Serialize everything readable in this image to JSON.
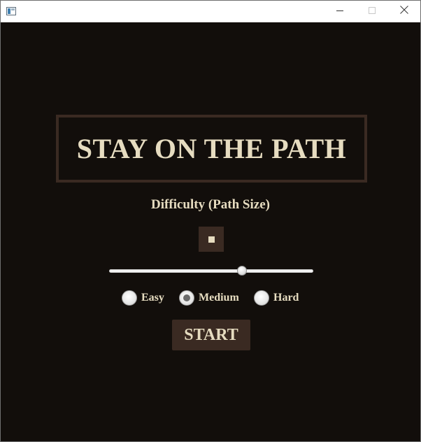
{
  "game": {
    "title": "STAY ON THE PATH",
    "difficulty_label": "Difficulty (Path Size)",
    "path_size_slider": {
      "value_fraction": 0.65
    },
    "difficulty_options": [
      {
        "label": "Easy",
        "selected": false
      },
      {
        "label": "Medium",
        "selected": true
      },
      {
        "label": "Hard",
        "selected": false
      }
    ],
    "start_label": "START"
  },
  "colors": {
    "background": "#120e0b",
    "accent_brown": "#3a2a22",
    "text_cream": "#e6dcc0"
  },
  "icons": {
    "app": "app-window-icon",
    "minimize": "minimize-icon",
    "maximize": "maximize-icon",
    "close": "close-icon"
  }
}
